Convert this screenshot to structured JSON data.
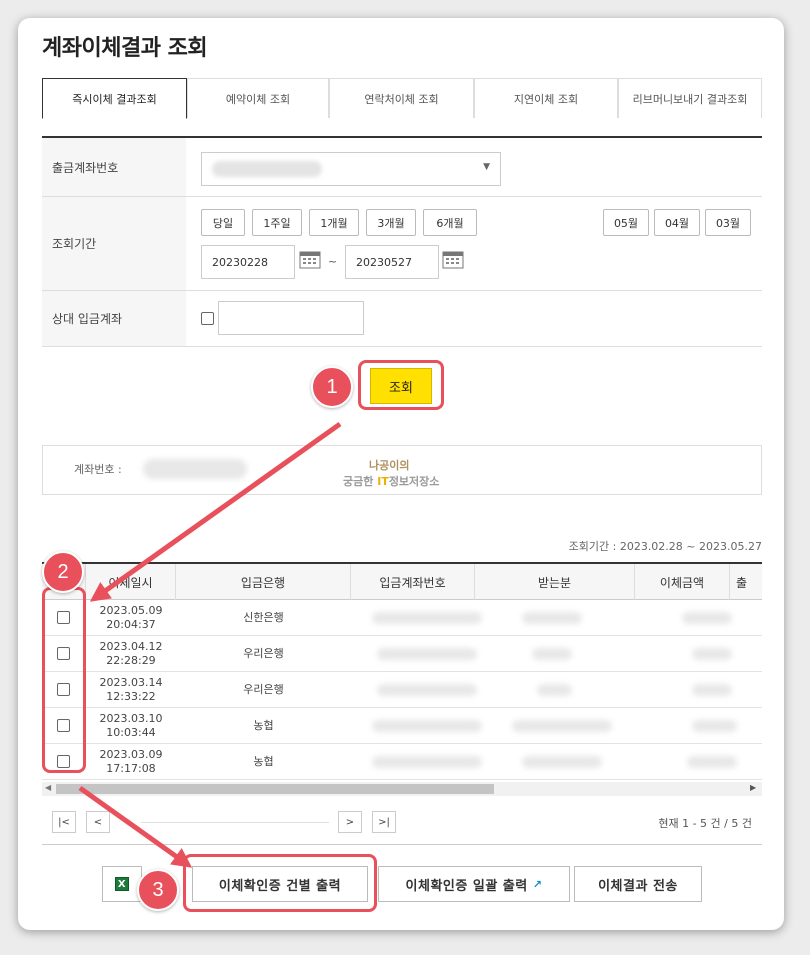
{
  "page": {
    "title": "계좌이체결과 조회"
  },
  "tabs": [
    {
      "label": "즉시이체 결과조회",
      "active": true
    },
    {
      "label": "예약이체 조회"
    },
    {
      "label": "연락처이체 조회"
    },
    {
      "label": "지연이체 조회"
    },
    {
      "label": "리브머니보내기 결과조회"
    }
  ],
  "form": {
    "account_label": "출금계좌번호",
    "period_label": "조회기간",
    "quick_periods": [
      "당일",
      "1주일",
      "1개월",
      "3개월",
      "6개월"
    ],
    "months": [
      "05월",
      "04월",
      "03월"
    ],
    "start_date": "20230228",
    "end_date": "20230527",
    "tilde": "~",
    "counterparty_label": "상대 입금계좌"
  },
  "search": {
    "label": "조회"
  },
  "badges": [
    "1",
    "2",
    "3"
  ],
  "account_box": {
    "label": "계좌번호 :"
  },
  "watermark": {
    "line1": "나공이의",
    "line2_a": "궁금한 ",
    "line2_it": "IT",
    "line2_b": "정보저장소"
  },
  "period_info": "조회기간 : 2023.02.28 ~ 2023.05.27",
  "table": {
    "headers": [
      "이체일시",
      "입금은행",
      "입금계좌번호",
      "받는분",
      "이체금액",
      "출"
    ],
    "rows": [
      {
        "date": "2023.05.09",
        "time": "20:04:37",
        "bank": "신한은행"
      },
      {
        "date": "2023.04.12",
        "time": "22:28:29",
        "bank": "우리은행"
      },
      {
        "date": "2023.03.14",
        "time": "12:33:22",
        "bank": "우리은행"
      },
      {
        "date": "2023.03.10",
        "time": "10:03:44",
        "bank": "농협"
      },
      {
        "date": "2023.03.09",
        "time": "17:17:08",
        "bank": "농협"
      }
    ]
  },
  "pagination": {
    "first": "|<",
    "prev": "<",
    "next": ">",
    "last": ">|",
    "count_text": "현재 1 - 5 건 / 5 건"
  },
  "actions": {
    "excel_icon": "X",
    "print_each": "이체확인증 건별 출력",
    "print_all": "이체확인증 일괄 출력",
    "send": "이체결과 전송",
    "external_icon": "↗"
  },
  "colors": {
    "accent": "#e8505b",
    "search_button": "#ffe000",
    "excel": "#1e7a3c"
  }
}
